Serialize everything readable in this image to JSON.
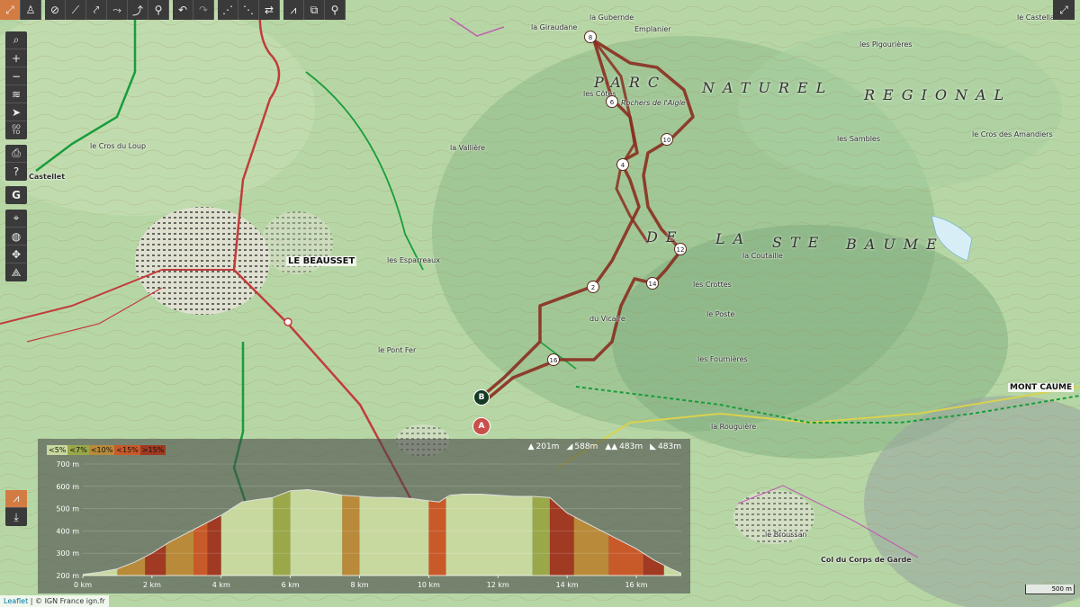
{
  "toolbar": {
    "icons": [
      "fit-icon",
      "hiker-icon",
      "hide-icon",
      "segment-icon",
      "segment2-icon",
      "route-icon",
      "bike-icon",
      "undo-icon",
      "redo-icon",
      "waypoints-icon",
      "waypoints2-icon",
      "swap-icon",
      "profile-tool-icon",
      "layers-copy-icon",
      "pin-icon"
    ]
  },
  "left_controls": {
    "zoom_in": "+",
    "zoom_out": "−",
    "goto_line1": "GO",
    "goto_line2": "TO"
  },
  "map": {
    "labels": {
      "le_beausset": "LE BEAUSSET",
      "mont_caume": "MONT CAUME",
      "parc": "PARC",
      "naturel": "NATUREL",
      "regional": "REGIONAL",
      "de": "DE",
      "la": "LA",
      "ste": "STE",
      "baume": "BAUME",
      "rochers": "Rochers de l'Aigle",
      "le_broussan": "le Broussan",
      "col_corps": "Col du Corps de Garde",
      "les_cotes": "les Côtes",
      "la_valliere": "la Vallière",
      "le_cros_du_loup": "le Cros du Loup",
      "le_castellet": "Castellet",
      "les_sambles": "les Sambles",
      "le_cros_amandiers": "le Cros des Amandiers",
      "la_gubernde": "la Gubernde",
      "emplanier": "Emplanier",
      "les_pigourieres": "les Pigourières",
      "le_castellas": "le Castellas",
      "les_crottes": "les Crottes",
      "le_vicaire": "du Vicaire",
      "le_poste": "le Poste",
      "les_fournieres": "les Fournières",
      "la_coutaille": "la Coutaille",
      "la_rouguiere": "la Rouguière",
      "la_giraudane": "la Giraudane",
      "les_esparreaux": "les Esparreaux",
      "le_pont_fer": "le Pont Fer"
    },
    "waypoints": [
      "2",
      "4",
      "6",
      "8",
      "10",
      "12",
      "14",
      "16"
    ],
    "start_marker": "A",
    "end_marker": "B",
    "scale": "500 m",
    "attribution_leaflet": "Leaflet",
    "attribution_rest": " | © IGN France ign.fr"
  },
  "elevation": {
    "legend": [
      {
        "label": "<5%",
        "color": "#c8d9a0"
      },
      {
        "label": "<7%",
        "color": "#9aa84a"
      },
      {
        "label": "<10%",
        "color": "#b88a3a"
      },
      {
        "label": "<15%",
        "color": "#c85a2a"
      },
      {
        "label": ">15%",
        "color": "#a03a22"
      }
    ],
    "stats": {
      "max_elevation": "201m",
      "ascent": "588m",
      "descent": "483m",
      "min": "483m"
    },
    "y_ticks": [
      "700 m",
      "600 m",
      "500 m",
      "400 m",
      "300 m",
      "200 m"
    ],
    "x_ticks": [
      "0 km",
      "2 km",
      "4 km",
      "6 km",
      "8 km",
      "10 km",
      "12 km",
      "14 km",
      "16 km"
    ]
  },
  "chart_data": {
    "type": "area",
    "title": "",
    "xlabel": "",
    "ylabel": "",
    "ylim": [
      200,
      700
    ],
    "xlim": [
      0,
      17.3
    ],
    "x": [
      0,
      0.5,
      1,
      1.5,
      2,
      2.5,
      3,
      3.5,
      4,
      4.3,
      4.6,
      5,
      5.5,
      6,
      6.5,
      7,
      7.5,
      8,
      8.5,
      9,
      9.5,
      10,
      10.3,
      10.6,
      11,
      11.5,
      12,
      12.5,
      13,
      13.5,
      14,
      14.5,
      15,
      15.5,
      16,
      16.5,
      17,
      17.3
    ],
    "y": [
      205,
      215,
      230,
      260,
      300,
      350,
      390,
      430,
      470,
      500,
      530,
      540,
      550,
      580,
      585,
      575,
      560,
      555,
      550,
      550,
      545,
      535,
      530,
      560,
      565,
      565,
      560,
      555,
      555,
      550,
      480,
      440,
      400,
      360,
      320,
      270,
      230,
      210
    ],
    "segment_grades": [
      {
        "from": 0,
        "to": 1,
        "grade": "<5%"
      },
      {
        "from": 1,
        "to": 1.8,
        "grade": "<10%"
      },
      {
        "from": 1.8,
        "to": 2.4,
        "grade": ">15%"
      },
      {
        "from": 2.4,
        "to": 3.2,
        "grade": "<10%"
      },
      {
        "from": 3.2,
        "to": 3.6,
        "grade": "<15%"
      },
      {
        "from": 3.6,
        "to": 4.0,
        "grade": ">15%"
      },
      {
        "from": 4.0,
        "to": 5.5,
        "grade": "<5%"
      },
      {
        "from": 5.5,
        "to": 6.0,
        "grade": "<7%"
      },
      {
        "from": 6.0,
        "to": 7.5,
        "grade": "<5%"
      },
      {
        "from": 7.5,
        "to": 8.0,
        "grade": "<10%"
      },
      {
        "from": 8.0,
        "to": 10.0,
        "grade": "<5%"
      },
      {
        "from": 10.0,
        "to": 10.5,
        "grade": "<15%"
      },
      {
        "from": 10.5,
        "to": 13.0,
        "grade": "<5%"
      },
      {
        "from": 13.0,
        "to": 13.5,
        "grade": "<7%"
      },
      {
        "from": 13.5,
        "to": 14.2,
        "grade": ">15%"
      },
      {
        "from": 14.2,
        "to": 15.2,
        "grade": "<10%"
      },
      {
        "from": 15.2,
        "to": 16.2,
        "grade": "<15%"
      },
      {
        "from": 16.2,
        "to": 16.8,
        "grade": ">15%"
      },
      {
        "from": 16.8,
        "to": 17.3,
        "grade": "<5%"
      }
    ]
  }
}
